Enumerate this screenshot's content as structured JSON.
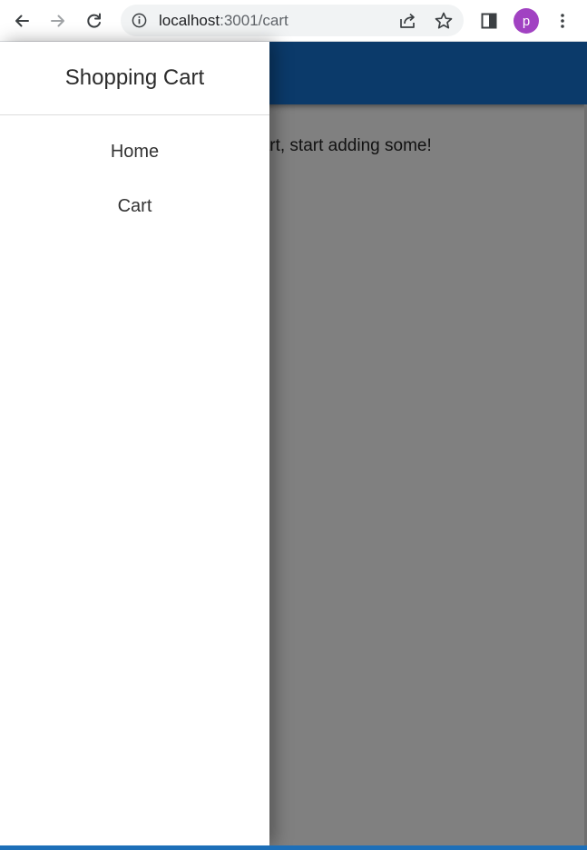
{
  "browser": {
    "url_host": "localhost",
    "url_path": ":3001/cart",
    "profile_initial": "p",
    "profile_color": "#a142c2"
  },
  "app": {
    "header_color": "#0b3a6a",
    "empty_message": "ping cart, start adding some!"
  },
  "drawer": {
    "title": "Shopping Cart",
    "items": [
      {
        "label": "Home"
      },
      {
        "label": "Cart"
      }
    ]
  },
  "icons": {
    "back": "arrow-left-icon",
    "forward": "arrow-right-icon",
    "reload": "reload-icon",
    "site_info": "info-icon",
    "share": "share-icon",
    "bookmark": "star-icon",
    "side_panel": "side-panel-icon",
    "menu": "kebab-menu-icon"
  }
}
